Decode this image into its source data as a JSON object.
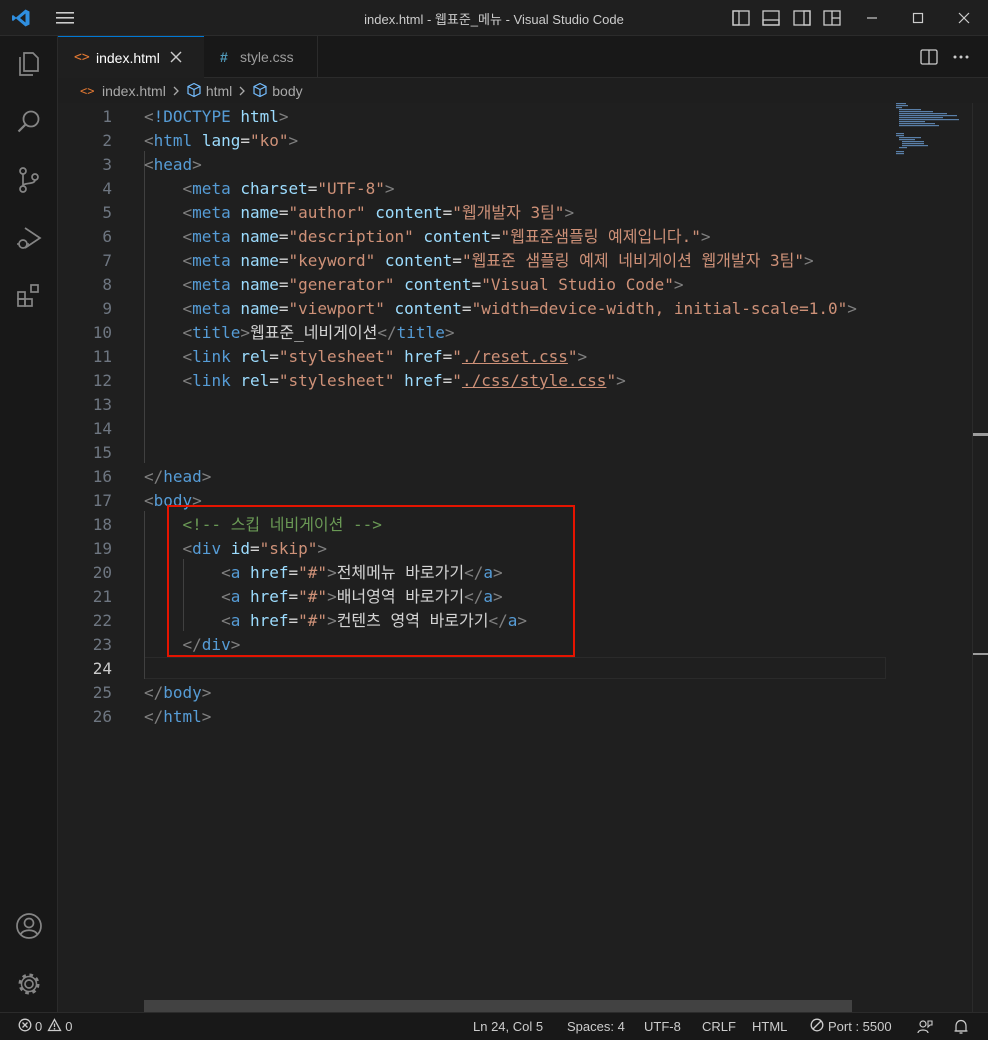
{
  "window": {
    "title": "index.html - 웹표준_메뉴 - Visual Studio Code"
  },
  "tabs": [
    {
      "label": "index.html",
      "icon": "html-file-icon",
      "active": true
    },
    {
      "label": "style.css",
      "icon": "css-file-icon",
      "active": false
    }
  ],
  "breadcrumb": {
    "file": "index.html",
    "items": [
      "html",
      "body"
    ]
  },
  "editor": {
    "current_line": 24,
    "lines": [
      {
        "n": "1"
      },
      {
        "n": "2"
      },
      {
        "n": "3"
      },
      {
        "n": "4"
      },
      {
        "n": "5"
      },
      {
        "n": "6"
      },
      {
        "n": "7"
      },
      {
        "n": "8"
      },
      {
        "n": "9"
      },
      {
        "n": "10"
      },
      {
        "n": "11"
      },
      {
        "n": "12"
      },
      {
        "n": "13"
      },
      {
        "n": "14"
      },
      {
        "n": "15"
      },
      {
        "n": "16"
      },
      {
        "n": "17"
      },
      {
        "n": "18"
      },
      {
        "n": "19"
      },
      {
        "n": "20"
      },
      {
        "n": "21"
      },
      {
        "n": "22"
      },
      {
        "n": "23"
      },
      {
        "n": "24"
      },
      {
        "n": "25"
      },
      {
        "n": "26"
      }
    ],
    "code": {
      "doctype_kw": "!DOCTYPE",
      "html": "html",
      "lang": "lang",
      "lang_val": "\"ko\"",
      "head": "head",
      "meta": "meta",
      "charset": "charset",
      "charset_val": "\"UTF-8\"",
      "name": "name",
      "content": "content",
      "author": "\"author\"",
      "author_val": "\"웹개발자 3팀\"",
      "description": "\"description\"",
      "description_val": "\"웹표준샘플링 예제입니다.\"",
      "keyword": "\"keyword\"",
      "keyword_val": "\"웹표준 샘플링 예제 네비게이션 웹개발자 3팀\"",
      "generator": "\"generator\"",
      "generator_val": "\"Visual Studio Code\"",
      "viewport": "\"viewport\"",
      "viewport_val": "\"width=device-width, initial-scale=1.0\"",
      "title": "title",
      "title_text": "웹표준_네비게이션",
      "link": "link",
      "rel": "rel",
      "stylesheet": "\"stylesheet\"",
      "href": "href",
      "reset_path": "./reset.css",
      "style_path": "./css/style.css",
      "body": "body",
      "comment": "<!-- 스킵 네비게이션 -->",
      "div": "div",
      "id": "id",
      "skip_val": "\"skip\"",
      "a": "a",
      "hash": "\"#\"",
      "link1": "전체메뉴 바로가기",
      "link2": "배너영역 바로가기",
      "link3": "컨텐츠 영역 바로가기"
    }
  },
  "statusbar": {
    "errors": "0",
    "warnings": "0",
    "position": "Ln 24, Col 5",
    "spaces": "Spaces: 4",
    "encoding": "UTF-8",
    "eol": "CRLF",
    "language": "HTML",
    "port": "Port : 5500"
  },
  "colors": {
    "accent": "#0078d4",
    "highlight_box": "#e51400",
    "background": "#1f1f1f"
  }
}
